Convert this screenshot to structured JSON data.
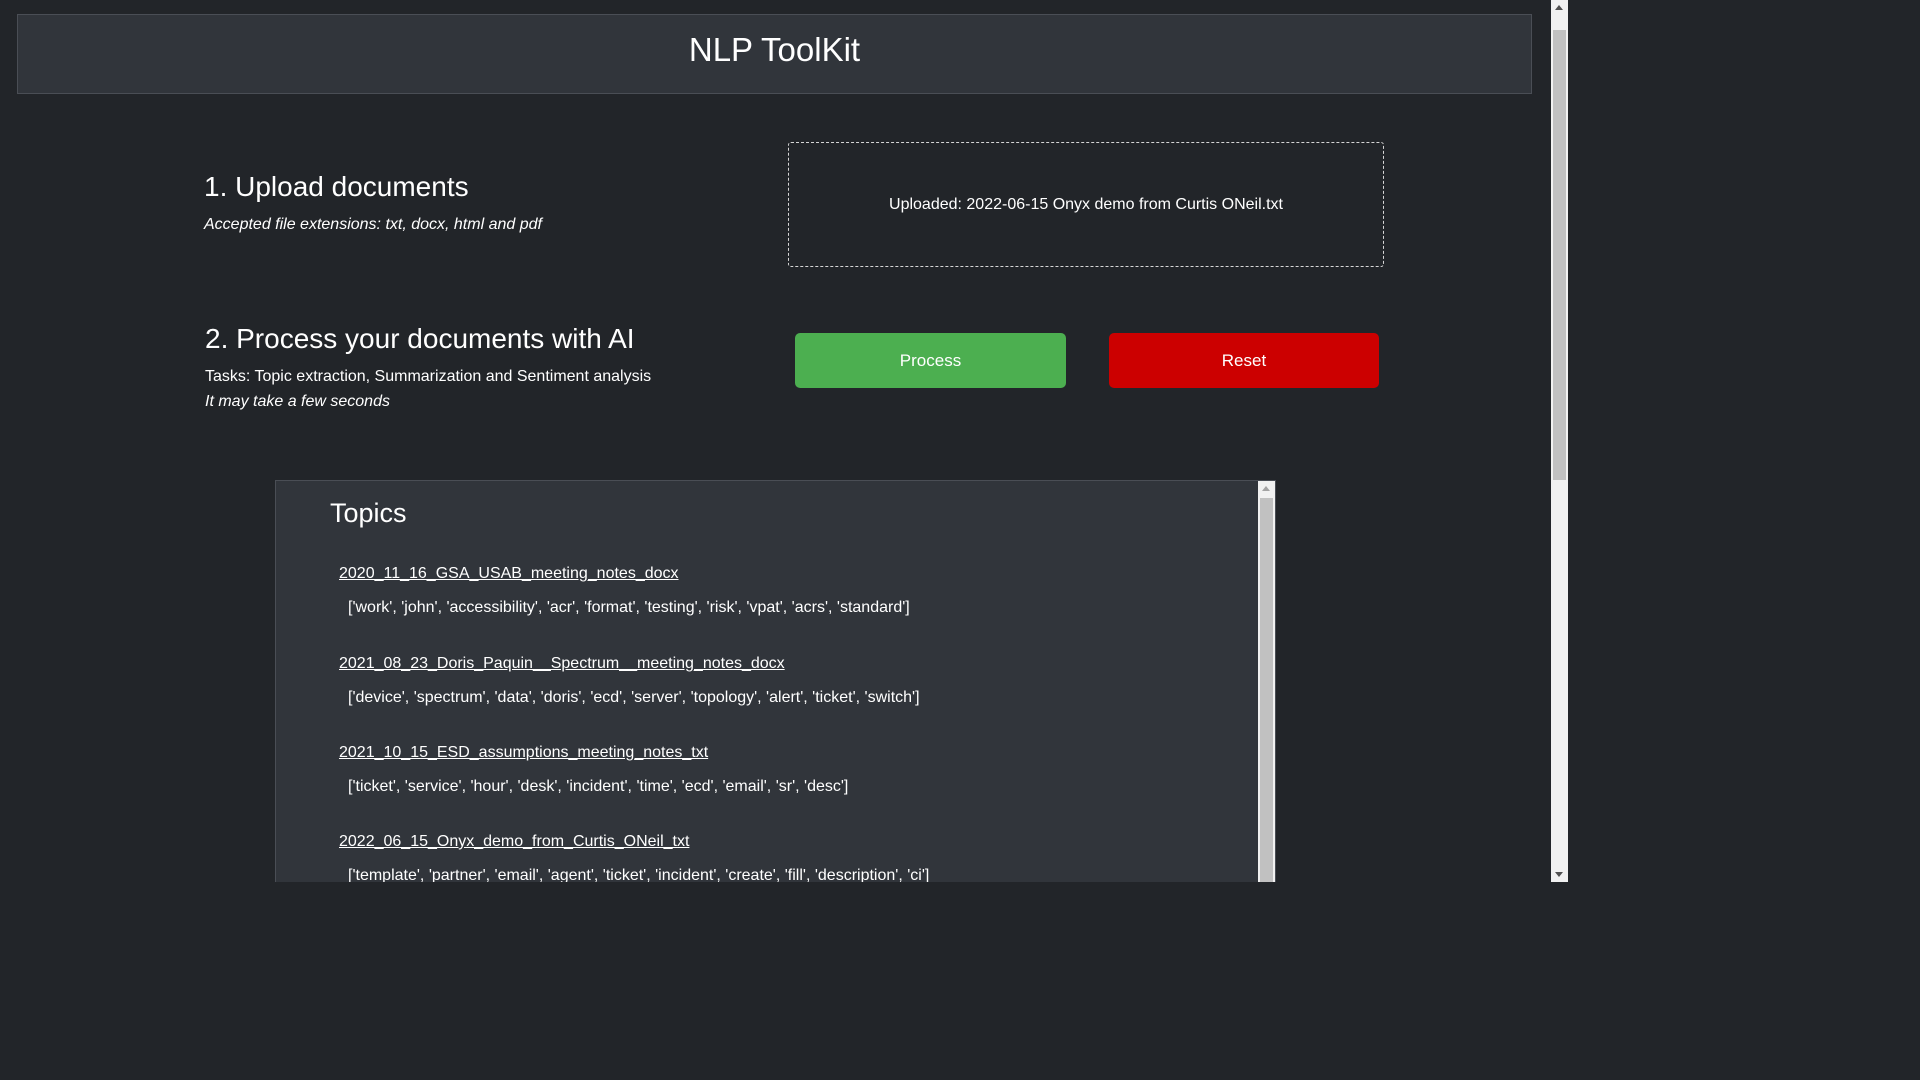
{
  "header": {
    "title": "NLP ToolKit"
  },
  "upload": {
    "title": "1. Upload documents",
    "subtitle": "Accepted file extensions: txt, docx, html and pdf",
    "status": "Uploaded: 2022-06-15 Onyx demo from Curtis ONeil.txt"
  },
  "process": {
    "title": "2. Process your documents with AI",
    "tasks": "Tasks: Topic extraction, Summarization and Sentiment analysis",
    "note": "It may take a few seconds",
    "process_label": "Process",
    "reset_label": "Reset"
  },
  "colors": {
    "process_button": "#4caf50",
    "reset_button": "#cc0000",
    "background": "#222529",
    "panel": "#31353b"
  },
  "topics": {
    "title": "Topics",
    "items": [
      {
        "name": "2020_11_16_GSA_USAB_meeting_notes_docx",
        "words": "['work', 'john', 'accessibility', 'acr', 'format', 'testing', 'risk', 'vpat', 'acrs', 'standard']"
      },
      {
        "name": "2021_08_23_Doris_Paquin__Spectrum__meeting_notes_docx",
        "words": "['device', 'spectrum', 'data', 'doris', 'ecd', 'server', 'topology', 'alert', 'ticket', 'switch']"
      },
      {
        "name": "2021_10_15_ESD_assumptions_meeting_notes_txt",
        "words": "['ticket', 'service', 'hour', 'desk', 'incident', 'time', 'ecd', 'email', 'sr', 'desc']"
      },
      {
        "name": "2022_06_15_Onyx_demo_from_Curtis_ONeil_txt",
        "words": "['template', 'partner', 'email', 'agent', 'ticket', 'incident', 'create', 'fill', 'description', 'ci']"
      }
    ]
  }
}
